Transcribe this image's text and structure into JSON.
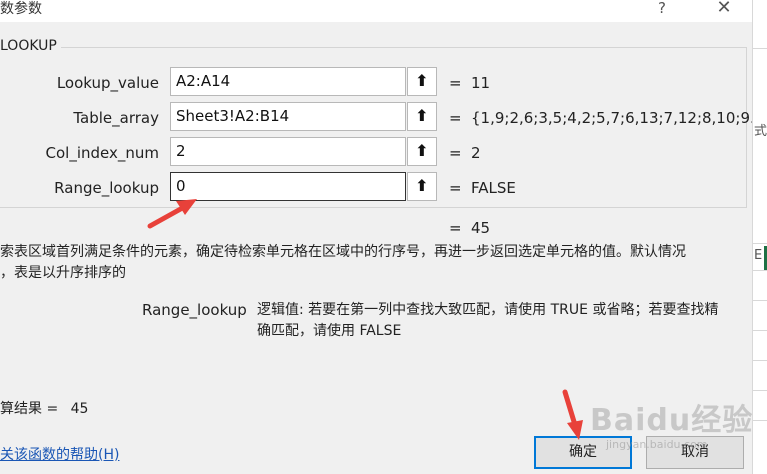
{
  "window": {
    "title": "数参数",
    "help_glyph": "?",
    "close_glyph": "✕"
  },
  "function_name": "LOOKUP",
  "args": [
    {
      "label": "Lookup_value",
      "value": "A2:A14",
      "result": "11"
    },
    {
      "label": "Table_array",
      "value": "Sheet3!A2:B14",
      "result": "{1,9;2,6;3,5;4,2;5,7;6,13;7,12;8,10;9..."
    },
    {
      "label": "Col_index_num",
      "value": "2",
      "result": "2"
    },
    {
      "label": "Range_lookup",
      "value": "0",
      "result": "FALSE"
    }
  ],
  "ref_glyph": "⬆",
  "equals": "=",
  "overall_result": "45",
  "description_line1": "索表区域首列满足条件的元素，确定待检索单元格在区域中的行序号，再进一步返回选定单元格的值。默认情况",
  "description_line2": "，表是以升序排序的",
  "arg_help": {
    "name": "Range_lookup",
    "text_line1": "逻辑值: 若要在第一列中查找大致匹配，请使用 TRUE 或省略；若要查找精",
    "text_line2": "确匹配，请使用 FALSE"
  },
  "formula_result_label": "算结果 =",
  "formula_result_value": "45",
  "help_link": "关该函数的帮助(H)",
  "ok_label": "确定",
  "cancel_label": "取消",
  "side": {
    "char_top": "式",
    "char_mid": "E"
  },
  "watermark": {
    "main": "Baidu经验",
    "sub": "jingyan.baidu.com"
  },
  "colors": {
    "accent": "#0078d7",
    "arrow": "#e8413a",
    "link": "#1a56b5"
  }
}
